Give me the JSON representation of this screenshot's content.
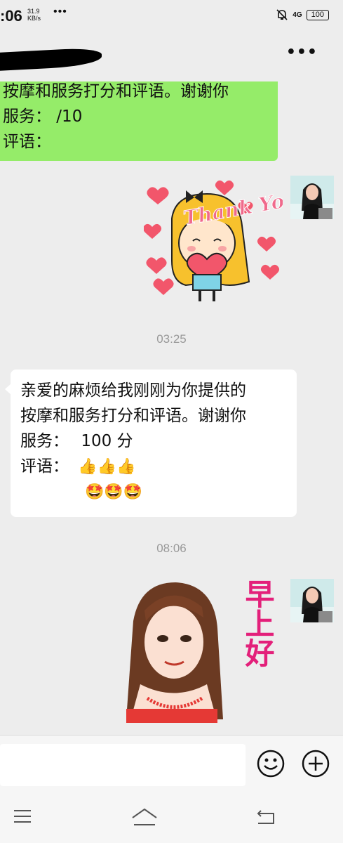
{
  "status_bar": {
    "time": ":06",
    "net_speed_value": "31.9",
    "net_speed_unit": "KB/s",
    "dots": "•••",
    "network": "4G",
    "battery": "100"
  },
  "header": {
    "more_label": "•••"
  },
  "messages": {
    "green_bubble": {
      "line1": "按摩和服务打分和评语。谢谢你",
      "line2": "服务：  /10",
      "line3": "评语："
    },
    "sticker_thank_you": {
      "text": "Thank You"
    },
    "timestamp1": "03:25",
    "white_bubble": {
      "line1": "亲爱的麻烦给我刚刚为你提供的",
      "line2": "按摩和服务打分和评语。谢谢你",
      "line3_label": "服务：",
      "line3_value": "100 分",
      "line4_label": "评语：",
      "thumbs": "👍👍👍",
      "faces": "🤩🤩🤩"
    },
    "timestamp2": "08:06",
    "sticker_good_morning": {
      "text": "早上好"
    }
  },
  "colors": {
    "green_bubble": "#95ec69",
    "background": "#ededed",
    "sticker_text": "#e3207a"
  }
}
